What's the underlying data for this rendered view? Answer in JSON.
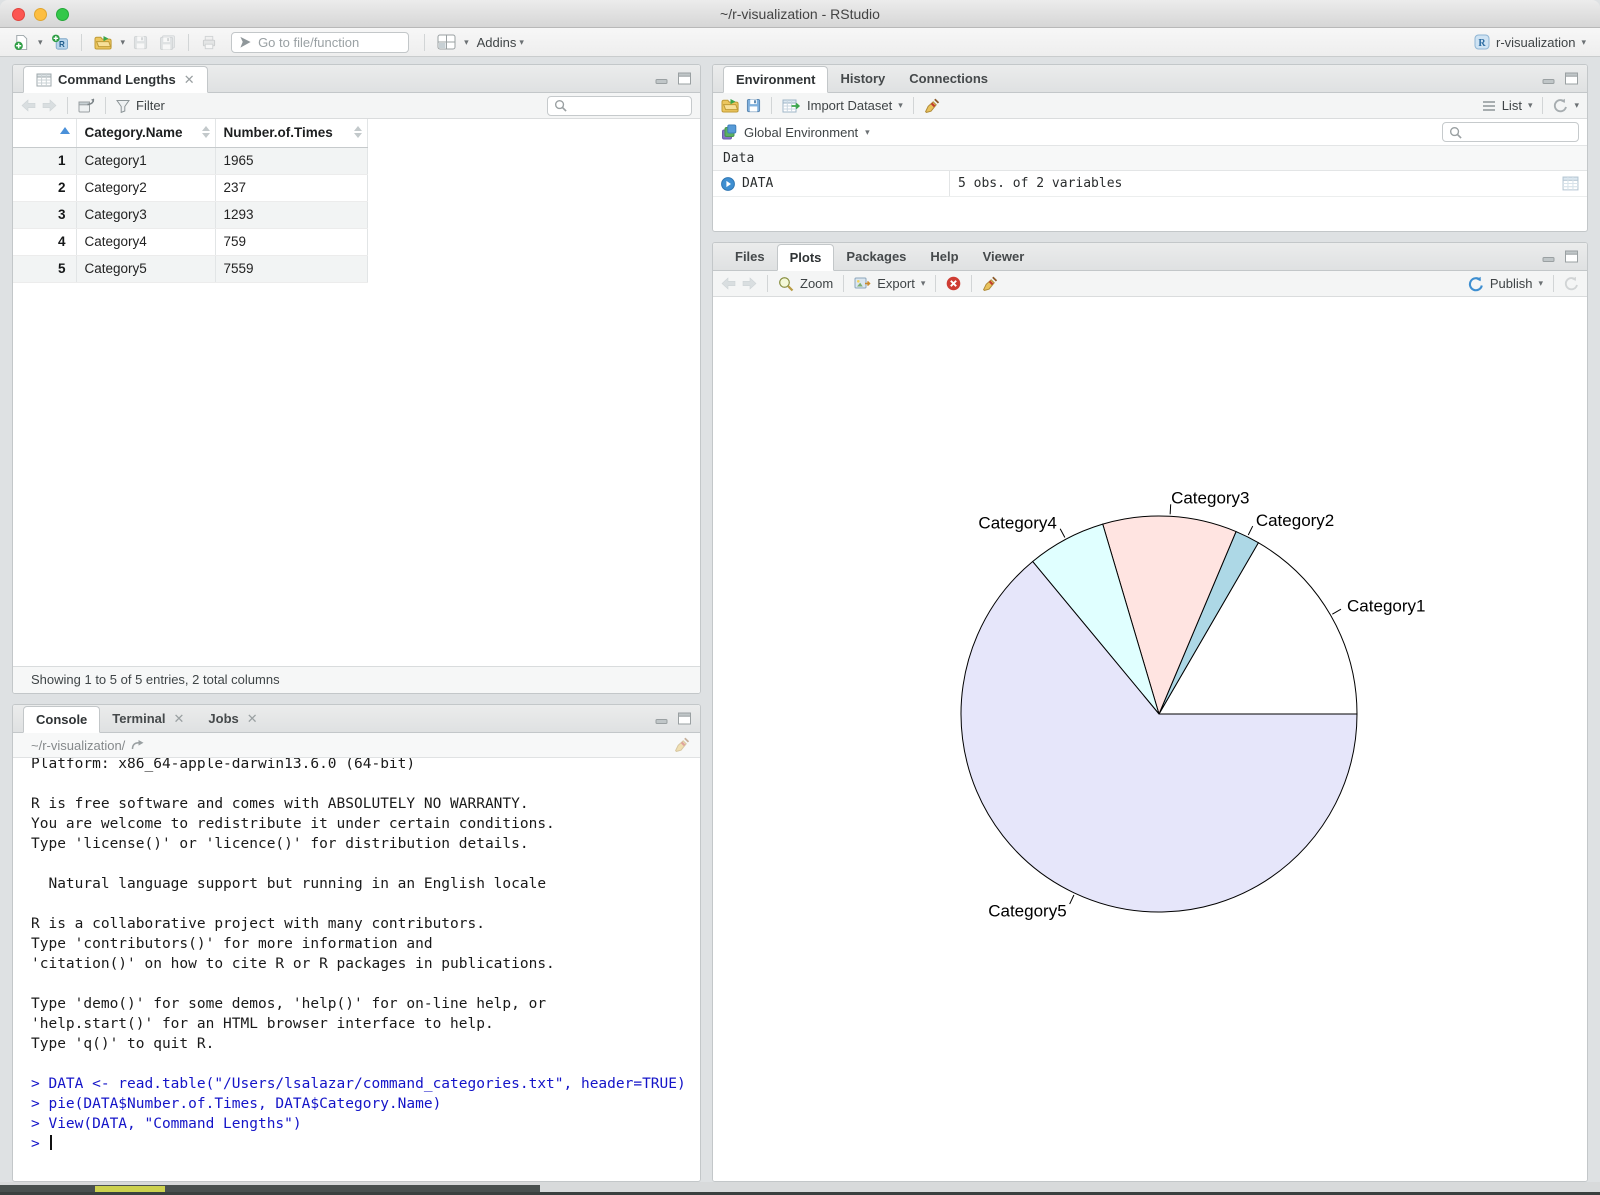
{
  "window": {
    "title": "~/r-visualization - RStudio"
  },
  "toolbar": {
    "goto_placeholder": "Go to file/function",
    "addins_label": "Addins",
    "project_label": "r-visualization"
  },
  "viewer": {
    "tab_title": "Command Lengths",
    "filter_label": "Filter",
    "table": {
      "columns": [
        "Category.Name",
        "Number.of.Times"
      ],
      "rows": [
        {
          "n": "1",
          "name": "Category1",
          "times": "1965"
        },
        {
          "n": "2",
          "name": "Category2",
          "times": "237"
        },
        {
          "n": "3",
          "name": "Category3",
          "times": "1293"
        },
        {
          "n": "4",
          "name": "Category4",
          "times": "759"
        },
        {
          "n": "5",
          "name": "Category5",
          "times": "7559"
        }
      ]
    },
    "footer": "Showing 1 to 5 of 5 entries, 2 total columns"
  },
  "environment": {
    "tabs": [
      "Environment",
      "History",
      "Connections"
    ],
    "import_dataset_label": "Import Dataset",
    "list_label": "List",
    "scope_label": "Global Environment",
    "section_label": "Data",
    "objects": [
      {
        "name": "DATA",
        "desc": "5 obs. of 2 variables"
      }
    ]
  },
  "plots": {
    "tabs": [
      "Files",
      "Plots",
      "Packages",
      "Help",
      "Viewer"
    ],
    "zoom_label": "Zoom",
    "export_label": "Export",
    "publish_label": "Publish"
  },
  "console": {
    "tabs": [
      "Console",
      "Terminal",
      "Jobs"
    ],
    "working_dir": "~/r-visualization/",
    "output_lines": [
      "Platform: x86_64-apple-darwin13.6.0 (64-bit)",
      "",
      "R is free software and comes with ABSOLUTELY NO WARRANTY.",
      "You are welcome to redistribute it under certain conditions.",
      "Type 'license()' or 'licence()' for distribution details.",
      "",
      "  Natural language support but running in an English locale",
      "",
      "R is a collaborative project with many contributors.",
      "Type 'contributors()' for more information and",
      "'citation()' on how to cite R or R packages in publications.",
      "",
      "Type 'demo()' for some demos, 'help()' for on-line help, or",
      "'help.start()' for an HTML browser interface to help.",
      "Type 'q()' to quit R.",
      ""
    ],
    "command_lines": [
      "> DATA <- read.table(\"/Users/lsalazar/command_categories.txt\", header=TRUE)",
      "> pie(DATA$Number.of.Times, DATA$Category.Name)",
      "> View(DATA, \"Command Lengths\")"
    ],
    "prompt": ">"
  },
  "chart_data": {
    "type": "pie",
    "categories": [
      "Category1",
      "Category2",
      "Category3",
      "Category4",
      "Category5"
    ],
    "values": [
      1965,
      237,
      1293,
      759,
      7559
    ],
    "colors": [
      "#FFFFFF",
      "#ADD8E6",
      "#FFE4E1",
      "#E0FFFF",
      "#E6E6FA"
    ],
    "start_angle_deg": 0,
    "direction": "counterclockwise",
    "stroke": "#000000",
    "title": ""
  }
}
